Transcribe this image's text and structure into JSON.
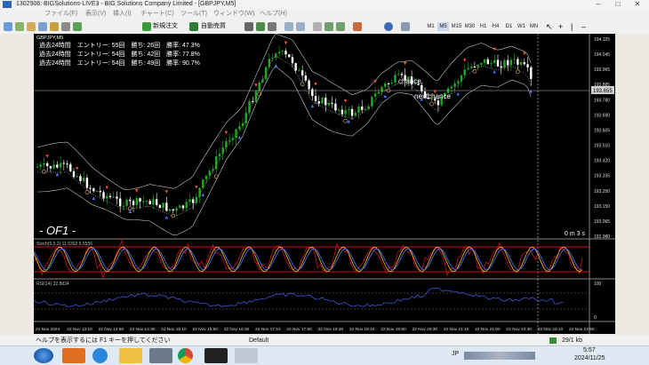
{
  "window": {
    "title": "1302906: BIGSolutions-LIVE3 - BIG Solutions Company Limited - [GBPJPY,M5]"
  },
  "menu": [
    "ファイル(F)",
    "表示(V)",
    "挿入(I)",
    "チャート(C)",
    "ツール(T)",
    "ウィンドウ(W)",
    "ヘルプ(H)"
  ],
  "toolbar": {
    "new_order": "新規注文",
    "auto_trade": "自動売買",
    "timeframes": [
      "M1",
      "M5",
      "M15",
      "M30",
      "H1",
      "H4",
      "D1",
      "W1",
      "MN"
    ]
  },
  "chart": {
    "symbol_label": "GBPJPY,M5",
    "stats": [
      "過去24時間　エントリー: 55回　勝ち: 26回　勝率: 47.3%",
      "過去24時間　エントリー: 54回　勝ち: 42回　勝率: 77.8%",
      "過去24時間　エントリー: 54回　勝ち: 49回　勝率: 90.7%"
    ],
    "chance_label": "chance",
    "nextchance_label": "nextchance",
    "watermark": "- OF1 -",
    "timer": "0 m 3 s",
    "current_price": "193.655",
    "price_ticks": [
      "194.125",
      "194.045",
      "193.965",
      "193.885",
      "193.780",
      "193.690",
      "193.605",
      "193.510",
      "193.420",
      "193.335",
      "193.250",
      "193.150",
      "193.065",
      "192.980"
    ],
    "time_ticks": [
      "21 Nov 2024",
      "22 Nov 13:10",
      "22 Nov 13:50",
      "22 Nov 14:30",
      "22 Nov 15:10",
      "22 Nov 15:50",
      "22 Nov 16:30",
      "22 Nov 17:10",
      "22 Nov 17:50",
      "22 Nov 18:30",
      "22 Nov 19:10",
      "22 Nov 19:50",
      "22 Nov 20:30",
      "22 Nov 21:10",
      "22 Nov 21:50",
      "22 Nov 22:30",
      "22 Nov 23:10",
      "22 Nov 23:50"
    ],
    "stoch_label": "Stoch(5,3,3) 11.5302 5.5556",
    "rsi_label": "RSI(14) 32.8834",
    "rsi_ticks": [
      "100",
      "0"
    ]
  },
  "statusbar": {
    "help_text": "ヘルプを表示するには F1 キーを押してください",
    "profile": "Default",
    "traffic": "29/1 kb"
  },
  "taskbar": {
    "time": "5:57",
    "date": "2024/11/25",
    "lang": "JP"
  },
  "colors": {
    "chart_bg": "#000000",
    "bull_candle": "#22aa22",
    "bear_candle": "#ffffff",
    "band": "#c8c8c8",
    "up_arrow": "#3a7bff",
    "down_arrow": "#ff5020",
    "stoch_red": "#d11010",
    "rsi_line": "#3a5ad8"
  }
}
